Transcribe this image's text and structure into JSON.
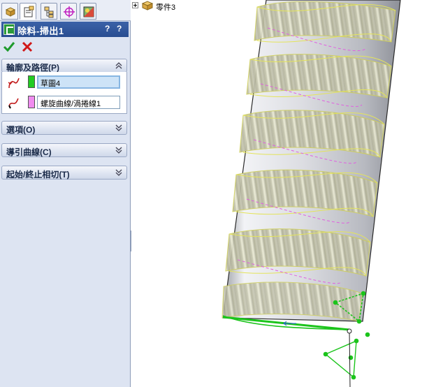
{
  "panel": {
    "tabs": [
      {
        "name": "feature-manager-tab",
        "icon": "feature-tree-icon"
      },
      {
        "name": "property-manager-tab",
        "icon": "property-sheet-icon",
        "active": true
      },
      {
        "name": "configuration-manager-tab",
        "icon": "configuration-icon"
      },
      {
        "name": "dimxpert-manager-tab",
        "icon": "crosshair-icon"
      },
      {
        "name": "display-manager-tab",
        "icon": "display-icon"
      }
    ],
    "title": "除料-掃出1",
    "help_label": "?",
    "help_label2": "?",
    "groups": {
      "profile_path": {
        "label": "輪廓及路徑(P)",
        "expanded": true
      },
      "options": {
        "label": "選項(O)",
        "expanded": false
      },
      "guide_curves": {
        "label": "導引曲線(C)",
        "expanded": false
      },
      "tangency": {
        "label": "起始/終止相切(T)",
        "expanded": false
      }
    },
    "profile_value": "草圖4",
    "path_value": "螺旋曲線/渦捲線1"
  },
  "colors": {
    "titlebar": "#294d91",
    "profile_swatch": "#22cc22",
    "path_swatch": "#f08cf0",
    "selection_field": "#cde3f7",
    "body_edges": "#e8e870",
    "helix_path": "#e060e0",
    "sketch": "#1bc41b"
  },
  "tree": {
    "part_label": "零件3"
  }
}
